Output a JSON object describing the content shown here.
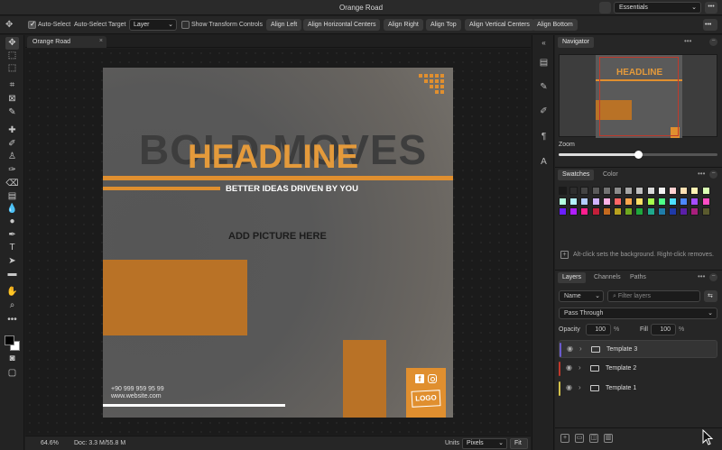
{
  "window": {
    "title": "Orange Road",
    "workspace": "Essentials"
  },
  "options": {
    "auto_select": "Auto-Select",
    "auto_select_target": "Auto-Select Target",
    "target_value": "Layer",
    "show_transform": "Show Transform Controls",
    "align_left": "Align Left",
    "align_hcenter": "Align Horizontal Centers",
    "align_right": "Align Right",
    "align_top": "Align Top",
    "align_vcenter": "Align Vertical Centers",
    "align_bottom": "Align Bottom"
  },
  "document": {
    "tab": "Orange Road"
  },
  "artboard": {
    "ghost": "BOLD MOVES",
    "headline": "HEADLINE",
    "subheadline": "BETTER IDEAS DRIVEN BY YOU",
    "add_picture": "ADD PICTURE HERE",
    "phone": "+90 999 959 95 99",
    "website": "www.website.com",
    "logo": "LOGO",
    "fb": "f"
  },
  "status": {
    "zoom": "64.6%",
    "doc": "Doc: 3.3 M/55.8 M",
    "units_label": "Units",
    "units_value": "Pixels",
    "fit": "Fit"
  },
  "navigator": {
    "tab": "Navigator",
    "zoom_label": "Zoom",
    "zoom_fraction": 0.5,
    "thumb_headline": "HEADLINE"
  },
  "swatches": {
    "tab_swatches": "Swatches",
    "tab_color": "Color",
    "hint": "Alt-click sets the background. Right-click removes.",
    "colors": [
      [
        "#1a1a1a",
        "#2e2e2e",
        "#444444",
        "#5a5a5a",
        "#737373",
        "#8c8c8c",
        "#a6a6a6",
        "#bfbfbf",
        "#d9d9d9",
        "#f2f2f2",
        "#ffd1d1",
        "#ffe0b3",
        "#fff2b3",
        "#d9ffb3"
      ],
      [
        "#b3ffe0",
        "#b3f2ff",
        "#b3ccff",
        "#d1b3ff",
        "#ffb3e6",
        "#ff6666",
        "#ffa64d",
        "#ffe066",
        "#a6ff4d",
        "#4dff88",
        "#4de1ff",
        "#4d88ff",
        "#a64dff",
        "#ff4dc4"
      ],
      [
        "#6a1fff",
        "#b01fff",
        "#ff1f8f",
        "#c41f3a",
        "#c46a1f",
        "#b8a11f",
        "#6fa81f",
        "#1fa83c",
        "#1fa88c",
        "#1f7ca8",
        "#1f3aa8",
        "#5a1fa8",
        "#a81f7c",
        "#5a5a2e"
      ]
    ]
  },
  "layers": {
    "tab_layers": "Layers",
    "tab_channels": "Channels",
    "tab_paths": "Paths",
    "filter_mode": "Name",
    "filter_placeholder": "Filter layers",
    "blend": "Pass Through",
    "opacity_label": "Opacity",
    "opacity": "100",
    "fill_label": "Fill",
    "fill": "100",
    "pct": "%",
    "items": [
      {
        "name": "Template 3",
        "color": "#6a5acd"
      },
      {
        "name": "Template 2",
        "color": "#c0392b"
      },
      {
        "name": "Template 1",
        "color": "#d4c24a"
      }
    ]
  }
}
